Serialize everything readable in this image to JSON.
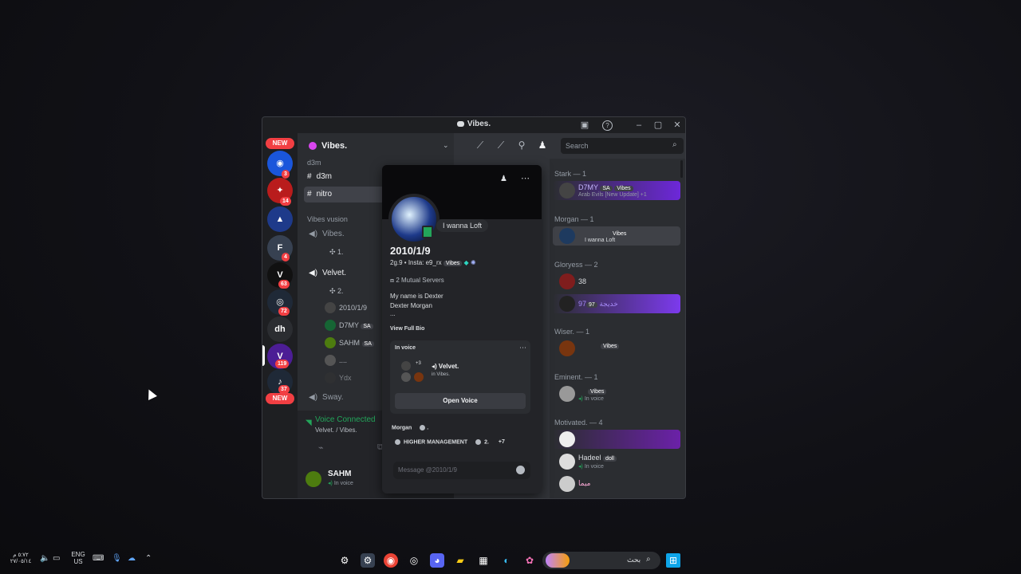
{
  "window": {
    "title": "Vibes."
  },
  "window_controls": {
    "minimize": "–",
    "maximize": "▢",
    "close": "✕"
  },
  "rail": {
    "new_top": "NEW",
    "new_bottom": "NEW",
    "badges": [
      "3",
      "14",
      "4",
      "63",
      "72",
      "119",
      "37"
    ],
    "dh_label": "dh"
  },
  "sidebar": {
    "server_name": "Vibes.",
    "category1": "d3m",
    "channels": [
      "d3m",
      "nitro"
    ],
    "category2": "Vibes vusion",
    "voice1": "Vibes.",
    "voice1_user": "1.",
    "voice2": "Velvet.",
    "voice2_users": [
      "2.",
      "2010/1/9",
      "D7MY",
      "SAHM",
      "....",
      "Ydx"
    ],
    "voice2_tags": [
      "SA",
      "SA"
    ],
    "voice3": "Sway."
  },
  "voice_panel": {
    "status": "Voice Connected",
    "channel": "Velvet. / Vibes."
  },
  "user_panel": {
    "name": "SAHM",
    "status": "In voice"
  },
  "toolbar": {
    "search_placeholder": "Search"
  },
  "popup": {
    "status_text": "I wanna Loft",
    "display_name": "2010/1/9",
    "handle_line": "2g.9 • Insta: e9_rx",
    "guild_tag": "Vibes",
    "mutual": "2 Mutual Servers",
    "bio_line1": "My name is Dexter",
    "bio_line2": "Dexter Morgan",
    "bio_line3": "...",
    "view_bio": "View Full Bio",
    "in_voice_label": "In voice",
    "voice_count": "+3",
    "voice_channel": "Velvet.",
    "voice_server": "in Vibes.",
    "open_voice": "Open Voice",
    "role1": "Morgan",
    "role1_extra": ".",
    "role2": "HIGHER MANAGEMENT",
    "role3": "2.",
    "more_roles": "+7",
    "message_placeholder": "Message @2010/1/9"
  },
  "members": {
    "groups": [
      {
        "name": "Stark — 1"
      },
      {
        "name": "Morgan — 1"
      },
      {
        "name": "Gloryess — 2"
      },
      {
        "name": "Wiser. — 1"
      },
      {
        "name": "Eminent. — 1"
      },
      {
        "name": "Motivated. — 4"
      }
    ],
    "d7my_name": "D7MY",
    "d7my_sub": "Arab Evils [New Update] +1",
    "morgan_sub": "I wanna Loft",
    "glory1": "38",
    "glory2": "97خديجة",
    "glory2_tag": "97",
    "hadeel": "Hadeel",
    "hadeel_tag": "doll",
    "hadeel_sub": "In voice",
    "last_name": "ميما",
    "in_voice": "In voice",
    "vibes_tag": "Vibes",
    "sa_tag": "SA"
  },
  "taskbar": {
    "lang": "ENG",
    "region": "US",
    "time": "٥:٧٢ م",
    "date": "٢٧/٠٥/١٤",
    "search_text": "بحث"
  },
  "colors": {
    "accent": "#5865f2",
    "online": "#23a55a",
    "danger": "#f23f43",
    "voice_green": "#23a55a",
    "nitro_purple": "#8b5cf6"
  }
}
